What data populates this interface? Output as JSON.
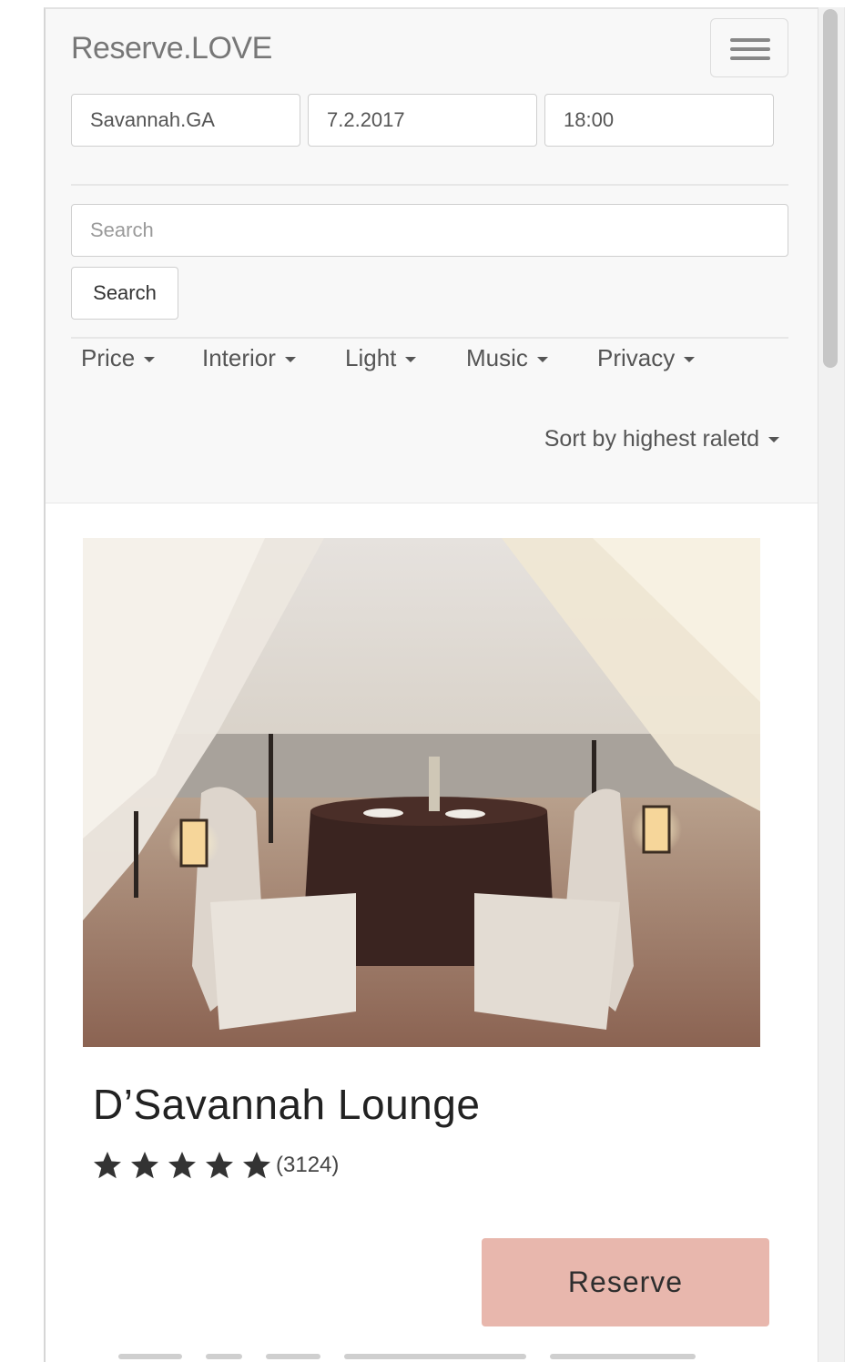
{
  "header": {
    "brand": "Reserve.LOVE",
    "menu_icon": "hamburger-menu-icon"
  },
  "query": {
    "location": "Savannah.GA",
    "date": "7.2.2017",
    "time": "18:00"
  },
  "search": {
    "placeholder": "Search",
    "button_label": "Search"
  },
  "filters": [
    {
      "label": "Price"
    },
    {
      "label": "Interior"
    },
    {
      "label": "Light"
    },
    {
      "label": "Music"
    },
    {
      "label": "Privacy"
    }
  ],
  "sort": {
    "label": "Sort by highest raletd"
  },
  "listing": {
    "name": "D’Savannah Lounge",
    "rating": 5,
    "rating_max": 5,
    "review_count": "(3124)",
    "reserve_label": "Reserve",
    "photo_icon": "beach-dinner-photo"
  },
  "colors": {
    "navbar_bg": "#f8f8f8",
    "reserve_button": "#e8b7ad",
    "brand_text": "#777777"
  }
}
